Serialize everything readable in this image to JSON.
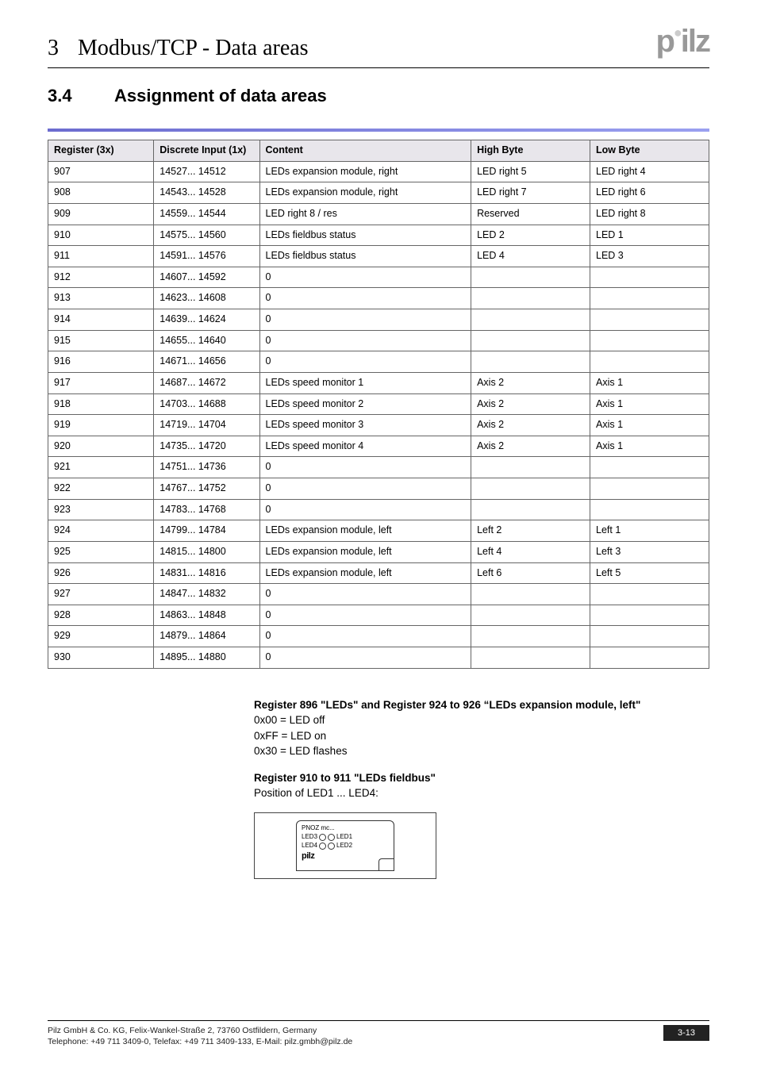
{
  "chapter": {
    "number": "3",
    "title": "Modbus/TCP - Data areas"
  },
  "brand": "pilz",
  "section": {
    "number": "3.4",
    "title": "Assignment of data areas"
  },
  "table": {
    "headers": {
      "register": "Register (3x)",
      "discrete": "Discrete Input (1x)",
      "content": "Content",
      "high": "High Byte",
      "low": "Low Byte"
    },
    "rows": [
      {
        "reg": "907",
        "di": "14527... 14512",
        "content": "LEDs expansion module, right",
        "high": "LED right 5",
        "low": "LED right 4"
      },
      {
        "reg": "908",
        "di": "14543... 14528",
        "content": "LEDs expansion module, right",
        "high": "LED right 7",
        "low": "LED right 6"
      },
      {
        "reg": "909",
        "di": "14559... 14544",
        "content": "LED right 8 / res",
        "high": "Reserved",
        "low": "LED right 8"
      },
      {
        "reg": "910",
        "di": "14575... 14560",
        "content": "LEDs fieldbus status",
        "high": "LED 2",
        "low": "LED 1"
      },
      {
        "reg": "911",
        "di": "14591... 14576",
        "content": "LEDs fieldbus status",
        "high": "LED 4",
        "low": "LED 3"
      },
      {
        "reg": "912",
        "di": "14607... 14592",
        "content": "0",
        "high": "",
        "low": ""
      },
      {
        "reg": "913",
        "di": "14623... 14608",
        "content": "0",
        "high": "",
        "low": ""
      },
      {
        "reg": "914",
        "di": "14639... 14624",
        "content": "0",
        "high": "",
        "low": ""
      },
      {
        "reg": "915",
        "di": "14655... 14640",
        "content": "0",
        "high": "",
        "low": ""
      },
      {
        "reg": "916",
        "di": "14671... 14656",
        "content": "0",
        "high": "",
        "low": ""
      },
      {
        "reg": "917",
        "di": "14687... 14672",
        "content": "LEDs speed monitor 1",
        "high": "Axis 2",
        "low": "Axis 1"
      },
      {
        "reg": "918",
        "di": "14703... 14688",
        "content": "LEDs speed monitor 2",
        "high": "Axis 2",
        "low": "Axis 1"
      },
      {
        "reg": "919",
        "di": "14719... 14704",
        "content": "LEDs speed monitor 3",
        "high": "Axis 2",
        "low": "Axis 1"
      },
      {
        "reg": "920",
        "di": "14735... 14720",
        "content": "LEDs speed monitor 4",
        "high": "Axis 2",
        "low": "Axis 1"
      },
      {
        "reg": "921",
        "di": "14751... 14736",
        "content": "0",
        "high": "",
        "low": ""
      },
      {
        "reg": "922",
        "di": "14767... 14752",
        "content": "0",
        "high": "",
        "low": ""
      },
      {
        "reg": "923",
        "di": "14783... 14768",
        "content": "0",
        "high": "",
        "low": ""
      },
      {
        "reg": "924",
        "di": "14799... 14784",
        "content": "LEDs expansion module, left",
        "high": "Left 2",
        "low": "Left 1"
      },
      {
        "reg": "925",
        "di": "14815... 14800",
        "content": "LEDs expansion module, left",
        "high": "Left 4",
        "low": "Left 3"
      },
      {
        "reg": "926",
        "di": "14831... 14816",
        "content": "LEDs expansion module, left",
        "high": "Left 6",
        "low": "Left 5"
      },
      {
        "reg": "927",
        "di": "14847... 14832",
        "content": "0",
        "high": "",
        "low": ""
      },
      {
        "reg": "928",
        "di": "14863... 14848",
        "content": "0",
        "high": "",
        "low": ""
      },
      {
        "reg": "929",
        "di": "14879... 14864",
        "content": "0",
        "high": "",
        "low": ""
      },
      {
        "reg": "930",
        "di": "14895... 14880",
        "content": "0",
        "high": "",
        "low": ""
      }
    ]
  },
  "body": {
    "heading1": "Register 896 \"LEDs\" and Register 924 to 926 “LEDs expansion module, left\"",
    "line1": "0x00 = LED off",
    "line2": "0xFF = LED on",
    "line3": "0x30 = LED flashes",
    "heading2": "Register 910 to 911 \"LEDs fieldbus\"",
    "line4": "Position of LED1 ... LED4:"
  },
  "diagram": {
    "model": "PNOZ mc...",
    "led3": "LED3",
    "led1": "LED1",
    "led4": "LED4",
    "led2": "LED2",
    "brand": "pilz"
  },
  "footer": {
    "line1": "Pilz GmbH & Co. KG, Felix-Wankel-Straße 2, 73760 Ostfildern, Germany",
    "line2": "Telephone: +49 711 3409-0, Telefax: +49 711 3409-133, E-Mail: pilz.gmbh@pilz.de",
    "page": "3-13"
  }
}
